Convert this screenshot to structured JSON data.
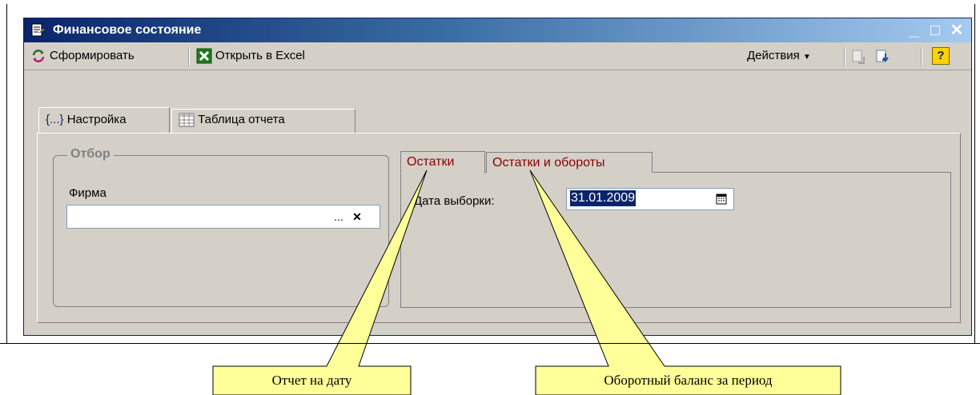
{
  "window": {
    "title": "Финансовое состояние",
    "minimize": "_",
    "maximize": "□",
    "close": "✕"
  },
  "toolbar": {
    "generate_label": "Сформировать",
    "excel_label": "Открыть в Excel",
    "actions_label": "Действия",
    "help_label": "?"
  },
  "tabs": [
    {
      "label": "Настройка"
    },
    {
      "label": "Таблица отчета"
    }
  ],
  "filter": {
    "group_label": "Отбор",
    "firm_label": "Фирма",
    "firm_value": "",
    "select_button": "...",
    "clear_button": "✕"
  },
  "subtabs": [
    {
      "label": "Остатки"
    },
    {
      "label": "Остатки и обороты"
    }
  ],
  "date": {
    "label": "Дата выборки:",
    "value": "31.01.2009"
  },
  "callouts": [
    {
      "text": "Отчет на дату"
    },
    {
      "text": "Оборотный баланс за период"
    }
  ],
  "colors": {
    "title_bar": "#0a246a",
    "window_bg": "#d4d0c8",
    "tab_text": "#8b0000",
    "callout_fill": "#ffff99"
  }
}
